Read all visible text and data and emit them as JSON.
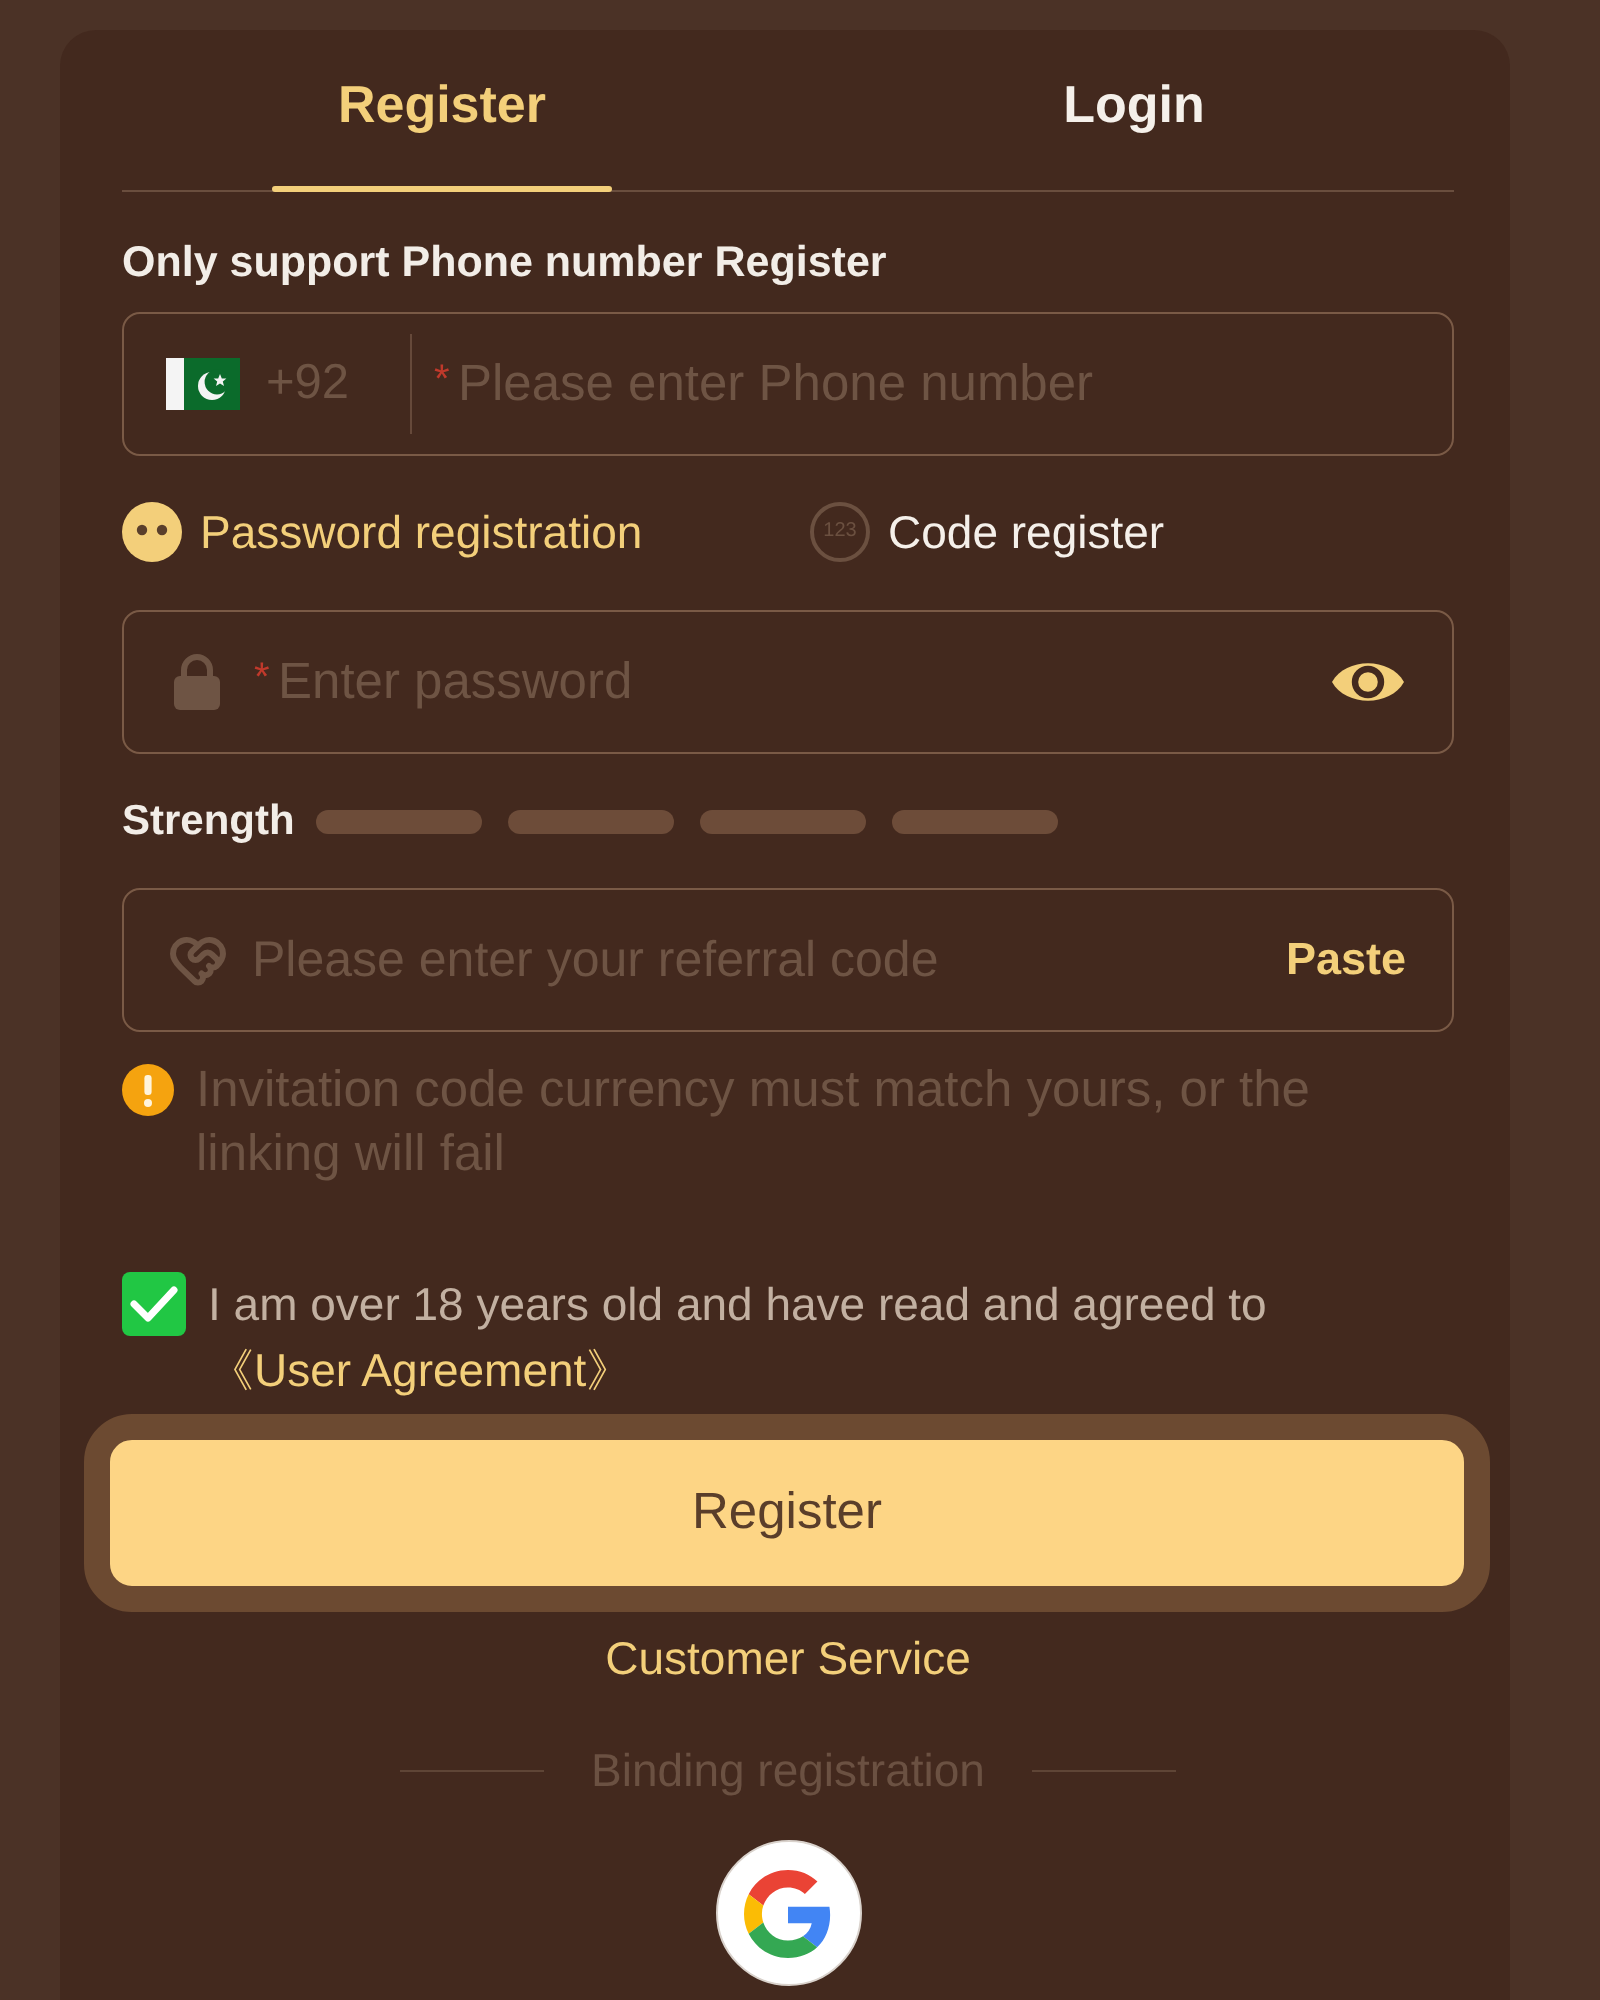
{
  "tabs": [
    {
      "label": "Register",
      "selected": true
    },
    {
      "label": "Login",
      "selected": false
    }
  ],
  "notice": "Only support Phone number Register",
  "phone_field": {
    "country_code": "+92",
    "required_mark": "*",
    "placeholder": "Please enter Phone number"
  },
  "register_modes": [
    {
      "kind": "password",
      "label": "Password registration",
      "selected": true
    },
    {
      "kind": "code",
      "icon_text": "123",
      "label": "Code register",
      "selected": false
    }
  ],
  "password_field": {
    "required_mark": "*",
    "placeholder": "Enter password"
  },
  "strength": {
    "label": "Strength",
    "segments": [
      {
        "lit": false
      },
      {
        "lit": false
      },
      {
        "lit": false
      },
      {
        "lit": false
      }
    ]
  },
  "referral_field": {
    "placeholder": "Please enter your referral code",
    "paste_button": "Paste"
  },
  "warning": "Invitation code currency must match yours, or the linking will fail",
  "agreement": {
    "checked": true,
    "text": "I am over 18 years old and have read and agreed to",
    "link": "《User Agreement》"
  },
  "register_button": "Register",
  "customer_service_link": "Customer Service",
  "binding_label": "Binding registration"
}
